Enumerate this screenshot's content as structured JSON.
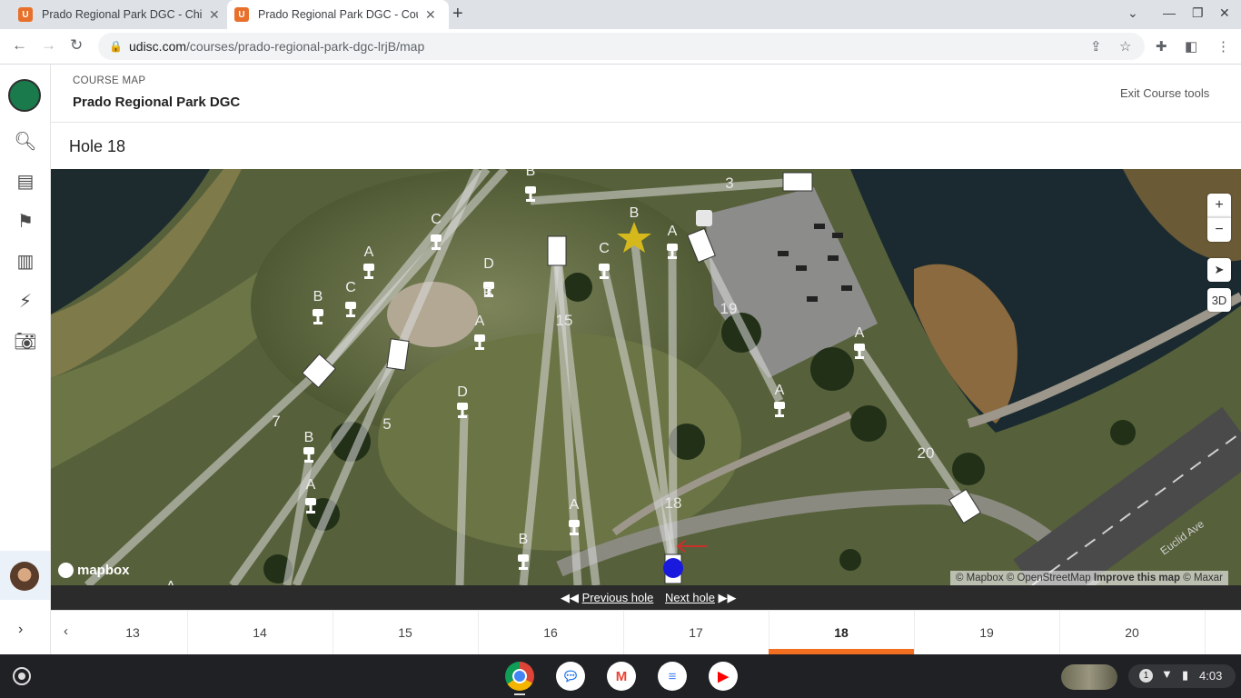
{
  "browser": {
    "tabs": [
      {
        "title": "Prado Regional Park DGC - Chino"
      },
      {
        "title": "Prado Regional Park DGC - Course"
      }
    ],
    "url_host": "udisc.com",
    "url_path": "/courses/prado-regional-park-dgc-lrjB/map"
  },
  "header": {
    "breadcrumb": "COURSE MAP",
    "course_name": "Prado Regional Park DGC",
    "exit_label": "Exit Course tools"
  },
  "hole": {
    "title": "Hole 18"
  },
  "map": {
    "zoom_in": "+",
    "zoom_out": "−",
    "mode_3d": "3D",
    "brand": "mapbox",
    "attribution": {
      "mapbox": "© Mapbox",
      "osm": "© OpenStreetMap",
      "improve": "Improve this map",
      "maxar": "© Maxar"
    },
    "hole_numbers": [
      "3",
      "15",
      "19",
      "7",
      "5",
      "18",
      "20"
    ],
    "basket_letters": [
      "B",
      "C",
      "A",
      "C",
      "B",
      "D",
      "B",
      "C",
      "A",
      "A",
      "D",
      "B",
      "A",
      "A",
      "A",
      "B",
      "A",
      "B",
      "A"
    ],
    "street_label": "Euclid Ave",
    "tee_color": "#ffffff",
    "target_color": "#d4b81c",
    "position_color": "#1a1adf"
  },
  "nav": {
    "prev_label": "Previous hole",
    "next_label": "Next hole"
  },
  "hole_tabs": {
    "labels": [
      "13",
      "14",
      "15",
      "16",
      "17",
      "18",
      "19",
      "20"
    ],
    "active": "18",
    "accent": "#f26f21"
  },
  "system": {
    "notification_count": "1",
    "time": "4:03"
  }
}
